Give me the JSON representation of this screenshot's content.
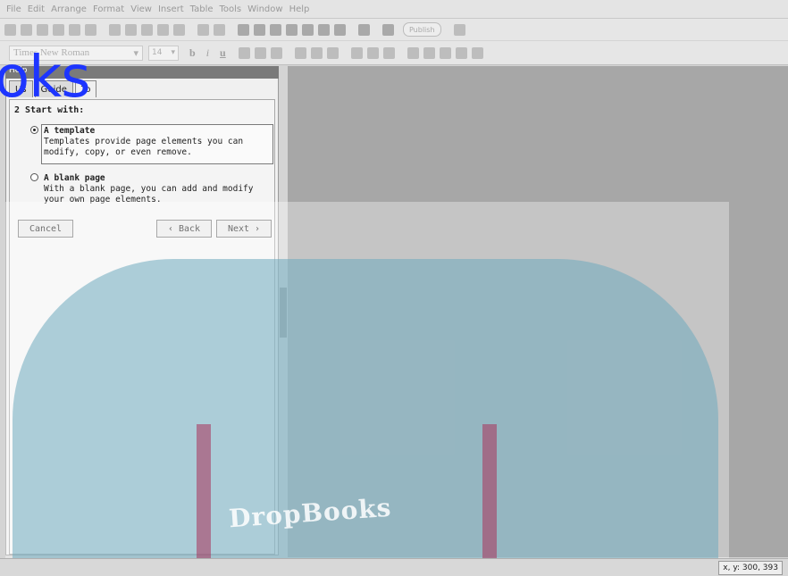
{
  "menu": [
    "File",
    "Edit",
    "Arrange",
    "Format",
    "View",
    "Insert",
    "Table",
    "Tools",
    "Window",
    "Help"
  ],
  "toolbar": {
    "publish_label": "Publish"
  },
  "format_bar": {
    "font": "Times New Roman",
    "size": "14",
    "bold": "b",
    "italic": "i",
    "underline": "u"
  },
  "panel": {
    "title": "Help",
    "tabs": [
      "Us",
      "Guide",
      "To"
    ],
    "overlay_text": "oks",
    "step_title": "2  Start with:",
    "options": [
      {
        "title": "A template",
        "desc": "Templates provide page elements you can modify, copy, or even remove.",
        "selected": true
      },
      {
        "title": "A blank page",
        "desc": "With a blank page, you can add and modify your own page elements.",
        "selected": false
      }
    ],
    "cancel": "Cancel",
    "back": "‹ Back",
    "next": "Next ›"
  },
  "watermark": {
    "text": "DropBooks"
  },
  "status": {
    "coords": "x, y: 300, 393"
  },
  "colors": {
    "accent_overlay": "#1d35ff",
    "panel_title_bg": "#7a7a7a"
  }
}
